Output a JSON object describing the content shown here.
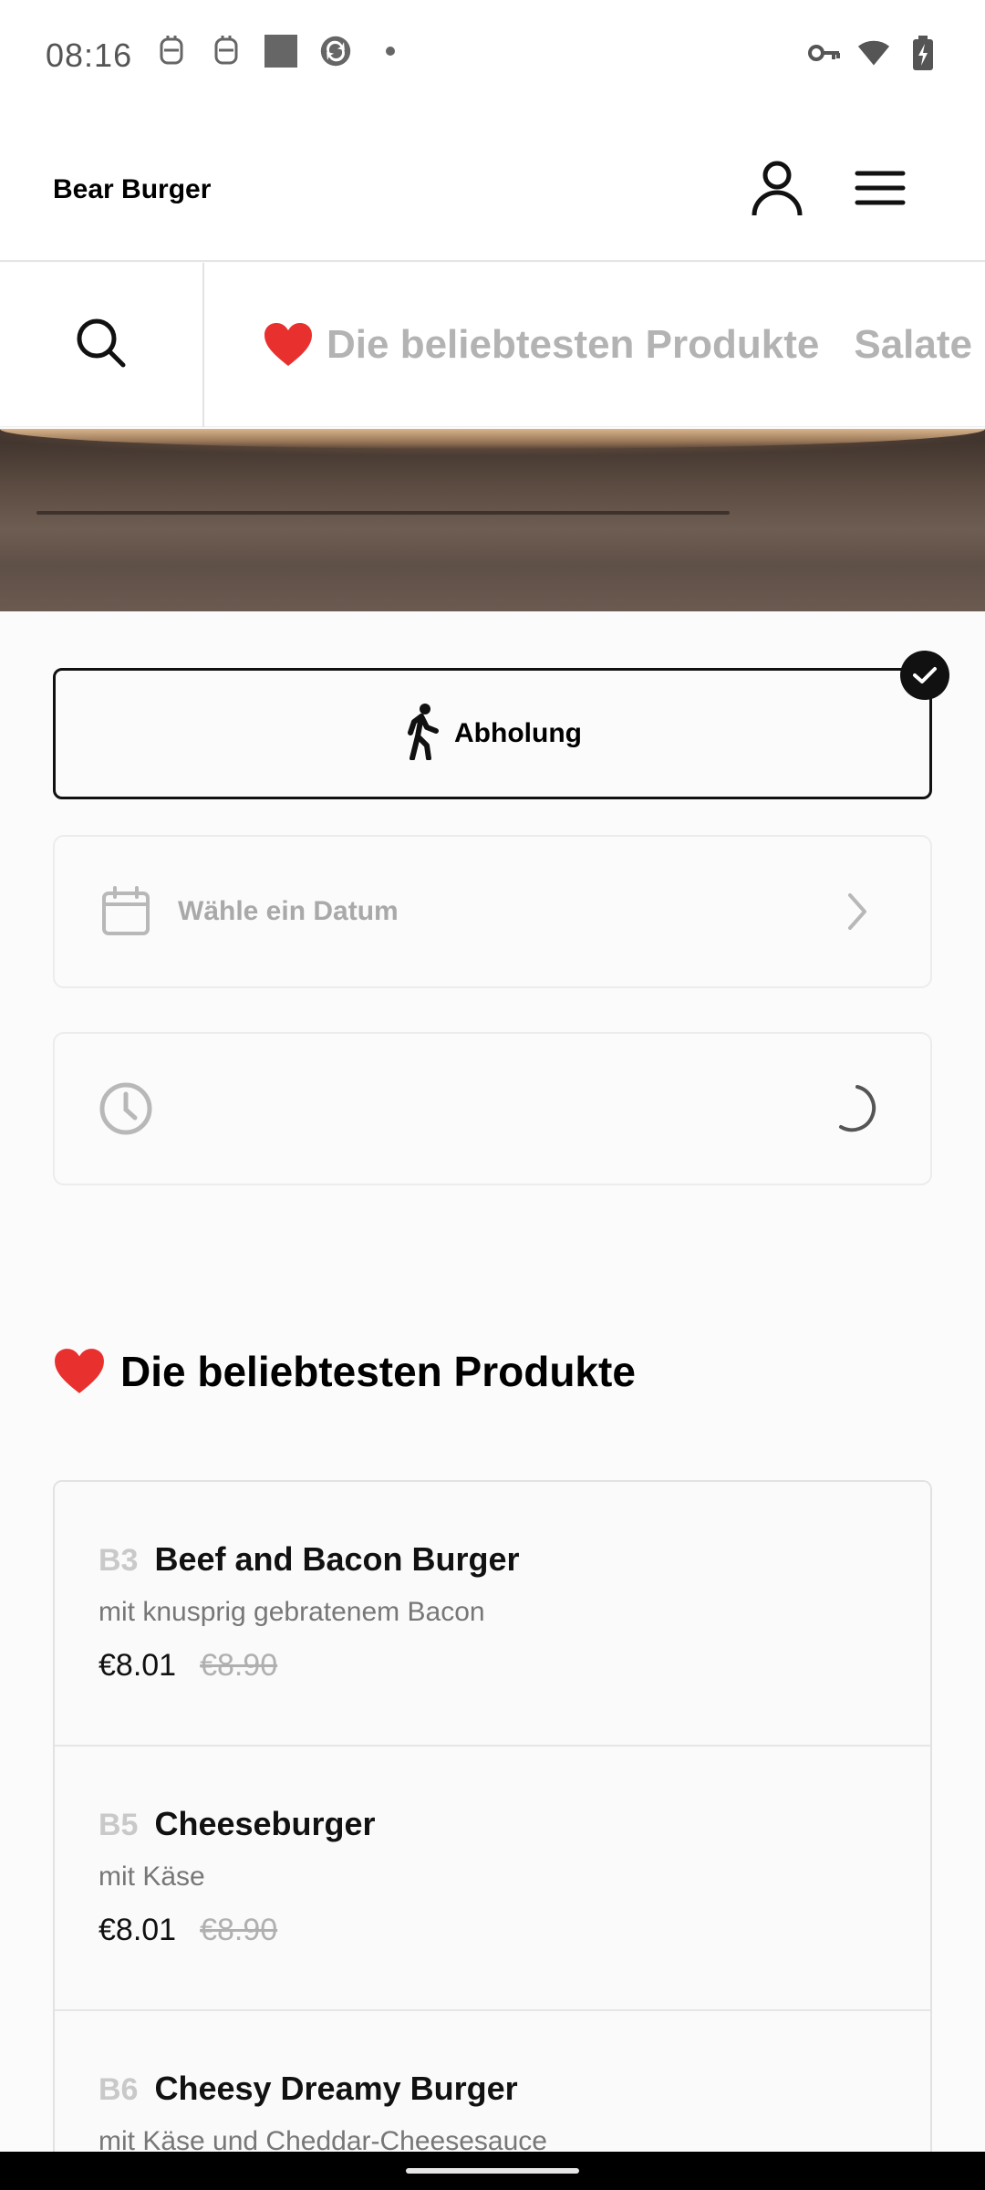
{
  "status_bar": {
    "time": "08:16",
    "left_icons": [
      "notification-icon",
      "notification-icon",
      "app-square-icon",
      "sync-icon",
      "dot-icon"
    ],
    "right_icons": [
      "key-icon",
      "wifi-icon",
      "battery-charging-icon"
    ]
  },
  "header": {
    "brand": "Bear Burger",
    "account_icon": "user-icon",
    "menu_icon": "hamburger-menu-icon"
  },
  "category_bar": {
    "search_icon": "search-icon",
    "tabs": [
      {
        "label": "Die beliebtesten Produkte",
        "icon": "heart-icon"
      },
      {
        "label": "Salate"
      }
    ]
  },
  "order": {
    "pickup_label": "Abholung",
    "pickup_selected": true,
    "date_placeholder": "Wähle ein Datum",
    "time_value": ""
  },
  "section": {
    "title": "Die beliebtesten Produkte"
  },
  "products": [
    {
      "code": "B3",
      "name": "Beef and Bacon Burger",
      "desc": "mit knusprig gebratenem Bacon",
      "price": "€8.01",
      "old_price": "€8.90"
    },
    {
      "code": "B5",
      "name": "Cheeseburger",
      "desc": "mit Käse",
      "price": "€8.01",
      "old_price": "€8.90"
    },
    {
      "code": "B6",
      "name": "Cheesy Dreamy Burger",
      "desc": "mit Käse und Cheddar-Cheesesauce",
      "price": "",
      "old_price": ""
    }
  ],
  "colors": {
    "accent": "#111111",
    "muted_text": "#a9a9a9",
    "heart": "#e8312f"
  }
}
